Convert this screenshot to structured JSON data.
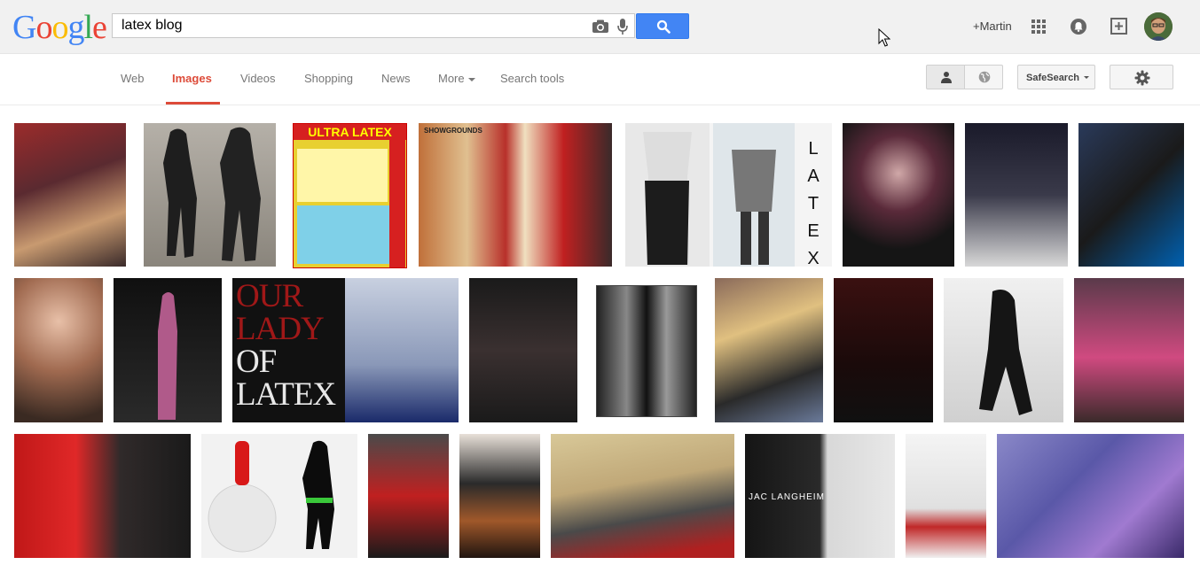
{
  "logo": {
    "letters": [
      "G",
      "o",
      "o",
      "g",
      "l",
      "e"
    ],
    "colors": [
      "#4285f4",
      "#ea4335",
      "#fbbc05",
      "#4285f4",
      "#34a853",
      "#ea4335"
    ]
  },
  "search": {
    "query": "latex blog"
  },
  "account": {
    "user_label": "+Martin"
  },
  "tabs": [
    {
      "label": "Web"
    },
    {
      "label": "Images"
    },
    {
      "label": "Videos"
    },
    {
      "label": "Shopping"
    },
    {
      "label": "News"
    },
    {
      "label": "More"
    },
    {
      "label": "Search tools"
    }
  ],
  "active_tab": "Images",
  "safesearch_label": "SafeSearch",
  "colors": {
    "accent_red": "#dd4b39",
    "search_blue": "#4285f4"
  },
  "thumbnails": {
    "row1": [
      "#6b3a3a",
      "#3a3a3a",
      "#e8d54a",
      "#a03a2a",
      "#c8c8c8",
      "#9a9a9a",
      "#2a2a2a",
      "#4a4a5a",
      "#3a3a4a"
    ],
    "row2": [
      "#c8a890",
      "#3a2a3a",
      "#1a1a1a",
      "#2a2a4a",
      "#2a2a2a",
      "#f0f0f0",
      "#8a7a6a",
      "#3a1a1a",
      "#d8d8d8",
      "#8a5a6a"
    ],
    "row3": [
      "#8a2a2a",
      "#e8e8e8",
      "#2a2a2a",
      "#3a3a3a",
      "#5a4a3a",
      "#2a2a2a",
      "#d8d0c8",
      "#8a7ab8"
    ]
  },
  "latex_caption_letters": [
    "L",
    "A",
    "T",
    "E",
    "X"
  ],
  "cover_text": {
    "ultra_latex": "ULTRA LATEX",
    "our_lady": [
      "OUR",
      "LADY",
      "OF",
      "LATEX"
    ],
    "brand": "JAC LANGHEIM",
    "showgrounds": "SHOWGROUNDS"
  }
}
